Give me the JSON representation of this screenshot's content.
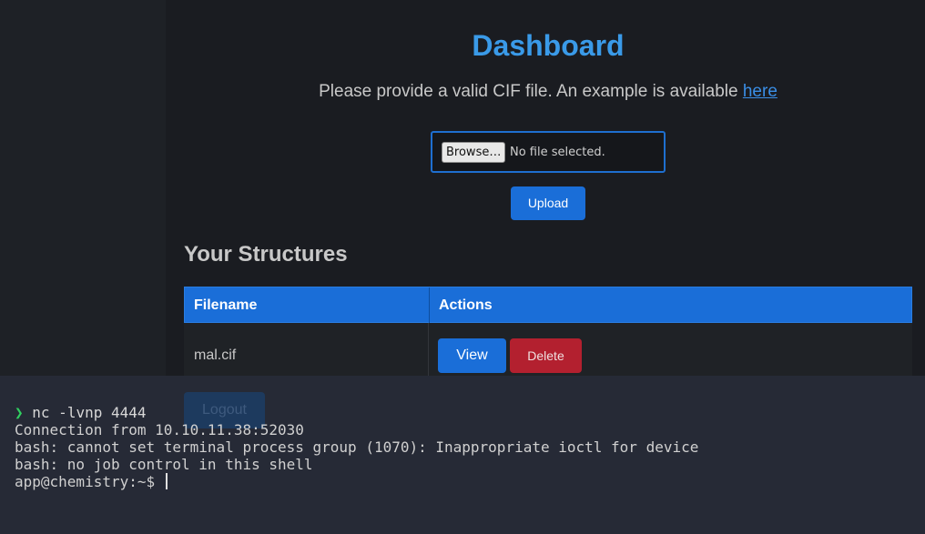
{
  "page": {
    "title": "Dashboard",
    "subtitle_text": "Please provide a valid CIF file. An example is available ",
    "subtitle_link": "here"
  },
  "upload": {
    "browse_label": "Browse…",
    "no_file_text": "No file selected.",
    "upload_label": "Upload"
  },
  "structures": {
    "heading": "Your Structures",
    "columns": [
      "Filename",
      "Actions"
    ],
    "rows": [
      {
        "filename": "mal.cif",
        "view_label": "View",
        "delete_label": "Delete"
      }
    ]
  },
  "logout_label": "Logout",
  "terminal": {
    "prompt_symbol": "❯",
    "command": "nc -lvnp 4444",
    "lines": [
      "Connection from 10.10.11.38:52030",
      "bash: cannot set terminal process group (1070): Inappropriate ioctl for device",
      "bash: no job control in this shell"
    ],
    "shell_prompt": "app@chemistry:~$ "
  },
  "colors": {
    "accent": "#1a6ed8",
    "title": "#3a9ae8",
    "danger": "#b3202f",
    "terminal_bg": "#262a36"
  }
}
